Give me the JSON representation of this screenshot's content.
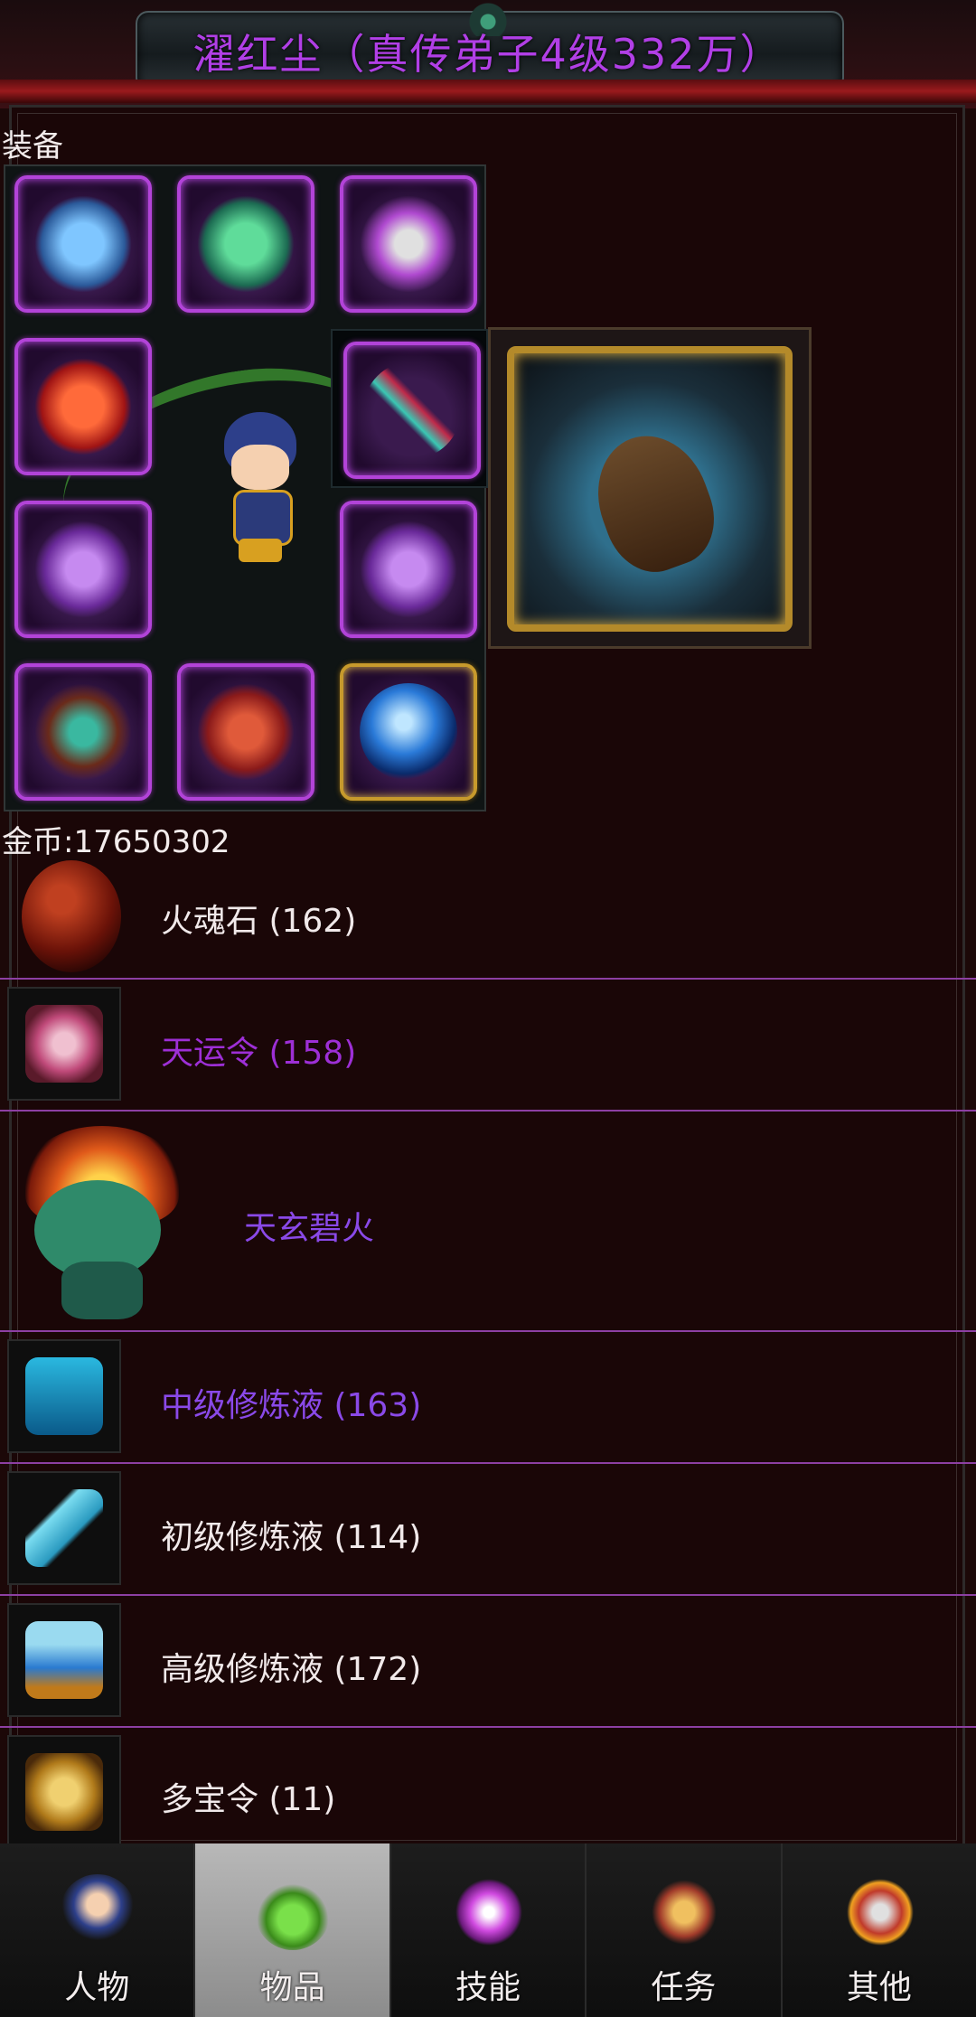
{
  "header": {
    "title": "濯红尘（真传弟子4级332万）"
  },
  "equipment": {
    "section_label": "装备",
    "slots": [
      {
        "name": "helmet",
        "icon": "blue-dragon-helmet-icon"
      },
      {
        "name": "armor",
        "icon": "green-armor-icon"
      },
      {
        "name": "weapon",
        "icon": "axe-weapon-icon"
      },
      {
        "name": "necklace",
        "icon": "red-phoenix-icon"
      },
      {
        "name": "spear",
        "icon": "teal-spear-icon"
      },
      {
        "name": "ring-left",
        "icon": "purple-ring-icon"
      },
      {
        "name": "ring-right",
        "icon": "purple-ring-icon"
      },
      {
        "name": "bracer",
        "icon": "bracer-icon"
      },
      {
        "name": "boots",
        "icon": "red-boots-icon"
      },
      {
        "name": "orb",
        "icon": "blue-orb-icon"
      }
    ],
    "preview_icon": "boat-mount-icon"
  },
  "gold": {
    "label": "金币:17650302"
  },
  "items": [
    {
      "label": "火魂石 (162)",
      "icon": "fire-stone-icon",
      "color": "#f1e9ea"
    },
    {
      "label": "天运令 (158)",
      "icon": "fortune-token-icon",
      "color": "#9d2fd6"
    },
    {
      "label": "天玄碧火",
      "icon": "flame-beast-icon",
      "color": "#8a49e8"
    },
    {
      "label": "中级修炼液 (163)",
      "icon": "mid-potion-icon",
      "color": "#8a49e8"
    },
    {
      "label": "初级修炼液 (114)",
      "icon": "low-potion-icon",
      "color": "#f1e9ea"
    },
    {
      "label": "高级修炼液 (172)",
      "icon": "high-potion-icon",
      "color": "#f1e9ea"
    },
    {
      "label": "多宝令 (11)",
      "icon": "treasure-token-icon",
      "color": "#f1e9ea"
    }
  ],
  "nav": {
    "tabs": [
      {
        "label": "人物",
        "icon": "character-icon",
        "active": false
      },
      {
        "label": "物品",
        "icon": "potion-bag-icon",
        "active": true
      },
      {
        "label": "技能",
        "icon": "skill-vortex-icon",
        "active": false
      },
      {
        "label": "任务",
        "icon": "quest-scroll-icon",
        "active": false
      },
      {
        "label": "其他",
        "icon": "other-blade-icon",
        "active": false
      }
    ]
  },
  "colors": {
    "title": "#b13fe6",
    "slot_border": "#b243d8",
    "divider": "#8d3fa3",
    "active_tab": "#a6a6a6"
  }
}
